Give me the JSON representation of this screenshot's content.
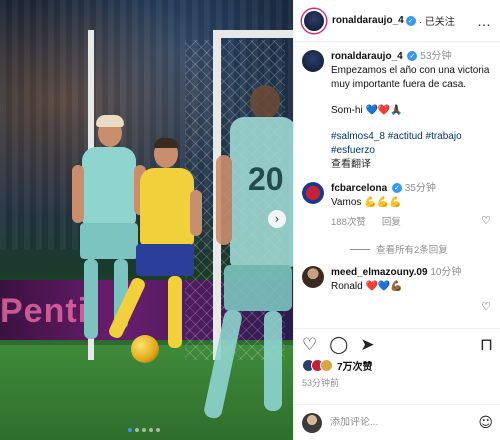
{
  "post": {
    "author": "ronaldaraujo_4",
    "follow_status": "已关注",
    "more_icon": "…"
  },
  "photo": {
    "adboard_text": "Penti",
    "jersey_number": "20",
    "carousel_dots": 5,
    "active_dot": 1
  },
  "caption": {
    "author": "ronaldaraujo_4",
    "time": "53分钟",
    "text": "Empezamos el año con una victoria muy importante fuera de casa.",
    "sign": "Som-hi 💙❤️🙏🏿",
    "hashtags": "#salmos4_8 #actitud #trabajo #esfuerzo",
    "translate": "查看翻译"
  },
  "comments": [
    {
      "author": "fcbarcelona",
      "time": "35分钟",
      "text": "Vamos 💪💪💪",
      "likes": "188次赞",
      "reply": "回复",
      "view_replies": "查看所有2条回复"
    },
    {
      "author": "meed_elmazouny.09",
      "time": "10分钟",
      "text": "Ronald ❤️💙💪🏾"
    }
  ],
  "actions": {
    "likes_count": "7万次赞",
    "posted_ago": "53分钟前"
  },
  "composer": {
    "placeholder": "添加评论..."
  },
  "colors": {
    "verified": "#3897f0",
    "hashtag": "#00376b",
    "story_ring": "#d62976"
  }
}
